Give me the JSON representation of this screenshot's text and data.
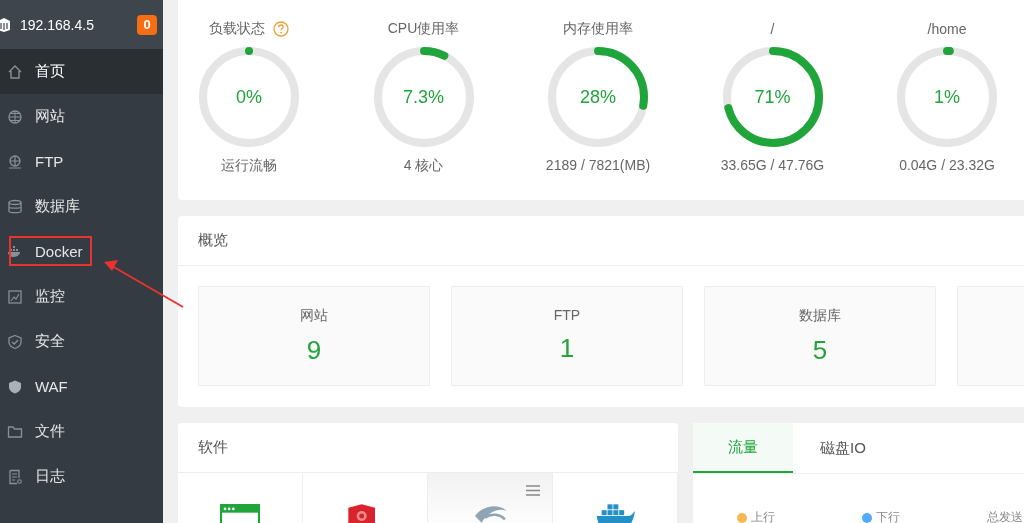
{
  "sidebar": {
    "host": "192.168.4.5",
    "badge": "0",
    "items": [
      {
        "label": "首页",
        "selected": true,
        "highlighted": false
      },
      {
        "label": "网站",
        "selected": false,
        "highlighted": false
      },
      {
        "label": "FTP",
        "selected": false,
        "highlighted": false
      },
      {
        "label": "数据库",
        "selected": false,
        "highlighted": false
      },
      {
        "label": "Docker",
        "selected": false,
        "highlighted": true
      },
      {
        "label": "监控",
        "selected": false,
        "highlighted": false
      },
      {
        "label": "安全",
        "selected": false,
        "highlighted": false
      },
      {
        "label": "WAF",
        "selected": false,
        "highlighted": false
      },
      {
        "label": "文件",
        "selected": false,
        "highlighted": false
      },
      {
        "label": "日志",
        "selected": false,
        "highlighted": false
      }
    ]
  },
  "gauges": [
    {
      "title": "负载状态",
      "help": true,
      "value": "0%",
      "level": 0,
      "caption": "运行流畅"
    },
    {
      "title": "CPU使用率",
      "help": false,
      "value": "7.3%",
      "level": 0.073,
      "caption": "4 核心"
    },
    {
      "title": "内存使用率",
      "help": false,
      "value": "28%",
      "level": 0.28,
      "caption": "2189 / 7821(MB)"
    },
    {
      "title": "/",
      "help": false,
      "value": "71%",
      "level": 0.71,
      "caption": "33.65G / 47.76G"
    },
    {
      "title": "/home",
      "help": false,
      "value": "1%",
      "level": 0.01,
      "caption": "0.04G / 23.32G"
    }
  ],
  "overview": {
    "title": "概览",
    "cards": [
      {
        "label": "网站",
        "value": "9"
      },
      {
        "label": "FTP",
        "value": "1"
      },
      {
        "label": "数据库",
        "value": "5"
      }
    ]
  },
  "software": {
    "title": "软件",
    "tiles": [
      {
        "hovered": false
      },
      {
        "hovered": false
      },
      {
        "hovered": true
      },
      {
        "hovered": false
      }
    ]
  },
  "traffic": {
    "tabs": [
      {
        "label": "流量",
        "selected": true
      },
      {
        "label": "磁盘IO",
        "selected": false
      }
    ],
    "legend": [
      {
        "label": "上行",
        "color": "#f7b851"
      },
      {
        "label": "下行",
        "color": "#52a9ff"
      }
    ],
    "stat_label": "总发送"
  }
}
